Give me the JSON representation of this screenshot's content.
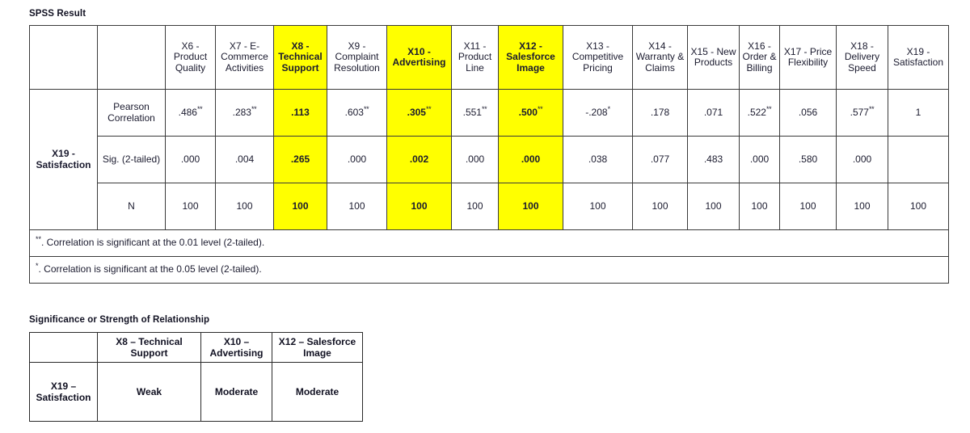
{
  "spss": {
    "title": "SPSS Result",
    "row_group_label": "X19 - Satisfaction",
    "measures": [
      {
        "label": "Pearson Correlation"
      },
      {
        "label": "Sig. (2-tailed)"
      },
      {
        "label": "N"
      }
    ],
    "columns": [
      {
        "id": "X6",
        "label": "X6 - Product Quality",
        "highlight": false
      },
      {
        "id": "X7",
        "label": "X7 - E-Commerce Activities",
        "highlight": false
      },
      {
        "id": "X8",
        "label": "X8 - Technical Support",
        "highlight": true
      },
      {
        "id": "X9",
        "label": "X9 - Complaint Resolution",
        "highlight": false
      },
      {
        "id": "X10",
        "label": "X10 - Advertising",
        "highlight": true
      },
      {
        "id": "X11",
        "label": "X11 - Product Line",
        "highlight": false
      },
      {
        "id": "X12",
        "label": "X12 - Salesforce Image",
        "highlight": true
      },
      {
        "id": "X13",
        "label": "X13 - Competitive Pricing",
        "highlight": false
      },
      {
        "id": "X14",
        "label": "X14 - Warranty & Claims",
        "highlight": false
      },
      {
        "id": "X15",
        "label": "X15 - New Products",
        "highlight": false
      },
      {
        "id": "X16",
        "label": "X16 - Order & Billing",
        "highlight": false
      },
      {
        "id": "X17",
        "label": "X17 - Price Flexibility",
        "highlight": false
      },
      {
        "id": "X18",
        "label": "X18 - Delivery Speed",
        "highlight": false
      },
      {
        "id": "X19",
        "label": "X19 - Satisfaction",
        "highlight": false
      }
    ],
    "pearson": [
      {
        "value": ".486",
        "sig": "**"
      },
      {
        "value": ".283",
        "sig": "**"
      },
      {
        "value": ".113",
        "sig": ""
      },
      {
        "value": ".603",
        "sig": "**"
      },
      {
        "value": ".305",
        "sig": "**"
      },
      {
        "value": ".551",
        "sig": "**"
      },
      {
        "value": ".500",
        "sig": "**"
      },
      {
        "value": "-.208",
        "sig": "*"
      },
      {
        "value": ".178",
        "sig": ""
      },
      {
        "value": ".071",
        "sig": ""
      },
      {
        "value": ".522",
        "sig": "**"
      },
      {
        "value": ".056",
        "sig": ""
      },
      {
        "value": ".577",
        "sig": "**"
      },
      {
        "value": "1",
        "sig": ""
      }
    ],
    "sig2tailed": [
      ".000",
      ".004",
      ".265",
      ".000",
      ".002",
      ".000",
      ".000",
      ".038",
      ".077",
      ".483",
      ".000",
      ".580",
      ".000",
      ""
    ],
    "n": [
      "100",
      "100",
      "100",
      "100",
      "100",
      "100",
      "100",
      "100",
      "100",
      "100",
      "100",
      "100",
      "100",
      "100"
    ],
    "footnotes": [
      {
        "marker": "**",
        "text": ". Correlation is significant at the 0.01 level (2-tailed)."
      },
      {
        "marker": "*",
        "text": ". Correlation is significant at the 0.05 level (2-tailed)."
      }
    ],
    "highlight_color": "#ffff00"
  },
  "strength": {
    "title": "Significance or Strength of Relationship",
    "row_label": "X19 – Satisfaction",
    "columns": [
      {
        "label": "X8 – Technical Support"
      },
      {
        "label": "X10 – Advertising"
      },
      {
        "label": "X12 – Salesforce Image"
      }
    ],
    "values": [
      "Weak",
      "Moderate",
      "Moderate"
    ]
  }
}
